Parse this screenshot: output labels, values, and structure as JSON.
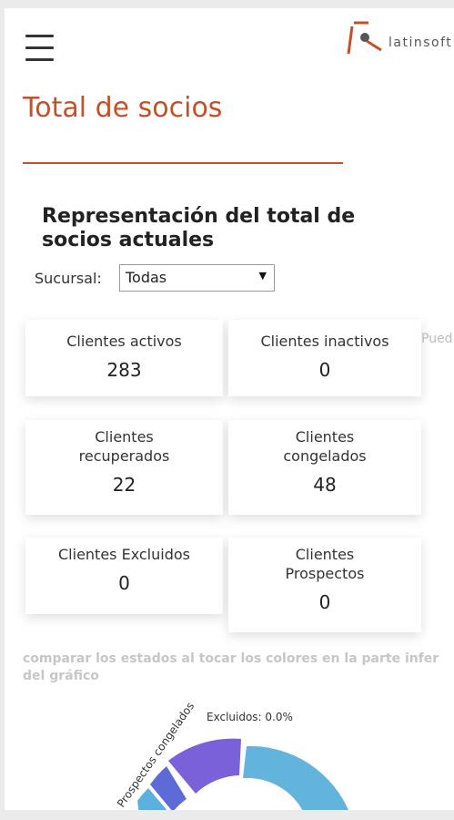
{
  "header": {
    "menu_icon": "hamburger-icon",
    "logo_text": "latinsoft"
  },
  "page": {
    "title": "Total de socios",
    "section_heading": "Representación del total de socios actuales",
    "accent_color": "#c4502a"
  },
  "filter": {
    "label": "Sucursal:",
    "value": "Todas"
  },
  "cards": [
    {
      "label": "Clientes activos",
      "value": "283"
    },
    {
      "label": "Clientes inactivos",
      "value": "0"
    },
    {
      "label": "Clientes recuperados",
      "value": "22"
    },
    {
      "label": "Clientes congelados",
      "value": "48"
    },
    {
      "label": "Clientes Excluidos",
      "value": "0"
    },
    {
      "label": "Clientes Prospectos",
      "value": "0"
    }
  ],
  "peek_text": "Pued",
  "hint_text": "comparar los estados al tocar los colores en la parte infer del gráfico",
  "donut": {
    "label_text": "Excluidos: 0.0%",
    "overlap_text": "Prospectos congelados",
    "colors": [
      "#62b4dc",
      "#7b61d9",
      "#5c6bd6",
      "#5cb0e0"
    ]
  }
}
